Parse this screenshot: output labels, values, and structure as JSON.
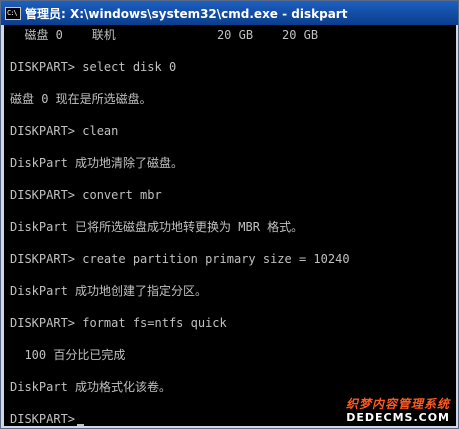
{
  "window": {
    "title": "管理员: X:\\windows\\system32\\cmd.exe - diskpart",
    "icon_text": "C:\\"
  },
  "console": {
    "lines": [
      "  磁盘 0    联机              20 GB    20 GB",
      "",
      "DISKPART> select disk 0",
      "",
      "磁盘 0 现在是所选磁盘。",
      "",
      "DISKPART> clean",
      "",
      "DiskPart 成功地清除了磁盘。",
      "",
      "DISKPART> convert mbr",
      "",
      "DiskPart 已将所选磁盘成功地转更换为 MBR 格式。",
      "",
      "DISKPART> create partition primary size = 10240",
      "",
      "DiskPart 成功地创建了指定分区。",
      "",
      "DISKPART> format fs=ntfs quick",
      "",
      "  100 百分比已完成",
      "",
      "DiskPart 成功格式化该卷。",
      "",
      "DISKPART>"
    ]
  },
  "watermark": {
    "line1": "织梦内容管理系统",
    "line2": "DEDECMS.COM"
  },
  "colors": {
    "titlebar": "#1450a8",
    "console_bg": "#000000",
    "console_text": "#c0c0c0",
    "watermark_top": "#ff5a1e"
  }
}
